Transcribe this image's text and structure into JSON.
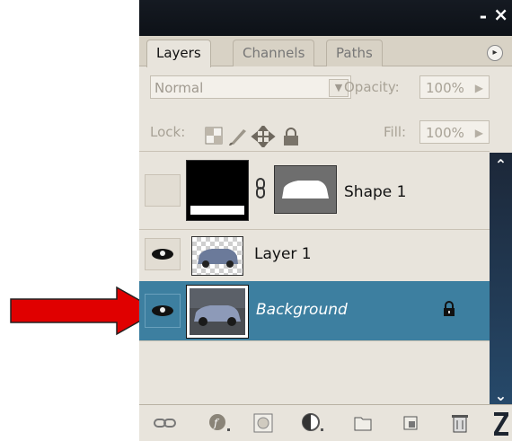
{
  "window": {
    "minimize": "-",
    "close": "×"
  },
  "tabs": [
    {
      "label": "Layers",
      "active": true
    },
    {
      "label": "Channels",
      "active": false
    },
    {
      "label": "Paths",
      "active": false
    }
  ],
  "panel_menu_icon": "▸",
  "blend_mode": {
    "value": "Normal"
  },
  "opacity": {
    "label": "Opacity:",
    "value": "100%"
  },
  "lock": {
    "label": "Lock:",
    "icons": [
      "lock-transparent-icon",
      "lock-brush-icon",
      "lock-move-icon",
      "lock-all-icon"
    ]
  },
  "fill": {
    "label": "Fill:",
    "value": "100%"
  },
  "layers": [
    {
      "name": "Shape 1",
      "visible": false,
      "type": "shape"
    },
    {
      "name": "Layer 1",
      "visible": true,
      "type": "raster"
    },
    {
      "name": "Background",
      "visible": true,
      "type": "background",
      "locked": true,
      "selected": true
    }
  ],
  "bottom_icons": [
    "link-layers-icon",
    "layer-style-icon",
    "layer-mask-icon",
    "adjustment-layer-icon",
    "new-group-icon",
    "new-layer-icon",
    "delete-layer-icon"
  ],
  "colors": {
    "selected": "#3d7fa0",
    "annotation_arrow": "#e00000",
    "titlebar": "#121720"
  }
}
